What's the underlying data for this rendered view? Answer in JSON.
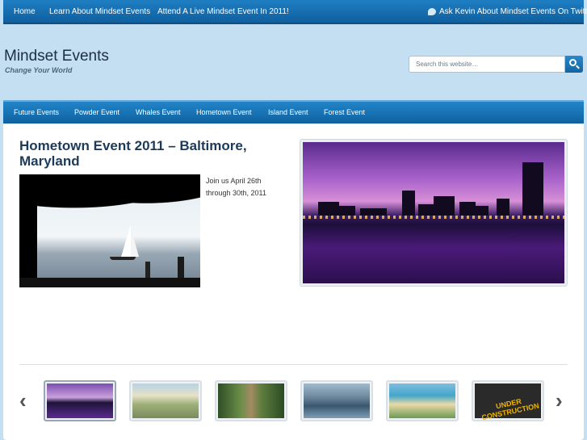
{
  "top_nav": {
    "items": [
      "Home",
      "Learn About Mindset Events",
      "Attend A Live Mindset Event In 2011!"
    ],
    "twitter_link": "Ask Kevin About Mindset Events On Twitter"
  },
  "header": {
    "title": "Mindset Events",
    "tagline": "Change Your World",
    "search_placeholder": "Search this website…"
  },
  "secondary_nav": {
    "items": [
      "Future Events",
      "Powder Event",
      "Whales Event",
      "Hometown Event",
      "Island Event",
      "Forest Event"
    ]
  },
  "post": {
    "title": "Hometown Event 2011 – Baltimore, Maryland",
    "body": "Join us April 26th through 30th, 2011"
  },
  "carousel": {
    "thumbnails": [
      "city-skyline",
      "coastal-cliffs",
      "forest-trail",
      "mountain-lake",
      "beach-bay",
      "under-construction"
    ],
    "under_construction_text": "UNDER CONSTRUCTION"
  },
  "colors": {
    "nav_blue": "#1676bb",
    "page_bg": "#c5dff2",
    "title_color": "#1c3a5a"
  }
}
